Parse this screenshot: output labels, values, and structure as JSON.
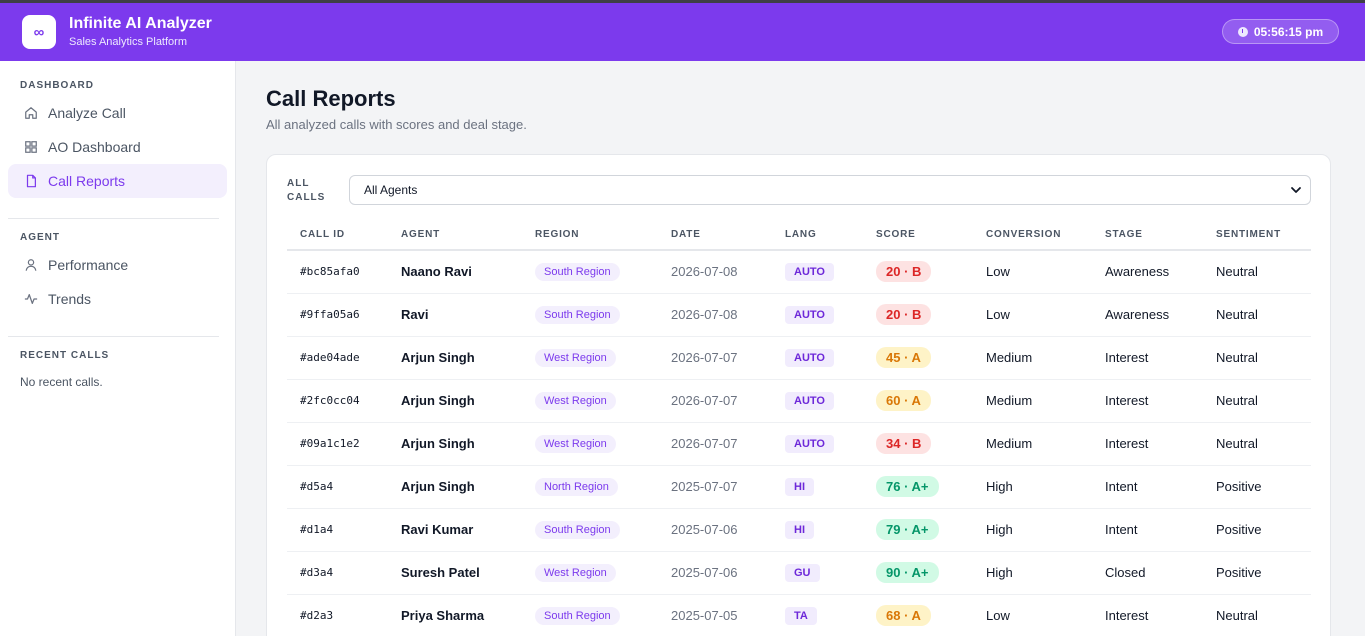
{
  "header": {
    "logo_glyph": "∞",
    "title": "Infinite AI Analyzer",
    "subtitle": "Sales Analytics Platform",
    "clock": "05:56:15 pm",
    "brand_color": "#7c3aed"
  },
  "sidebar": {
    "dashboard_label": "DASHBOARD",
    "dashboard_items": [
      {
        "label": "Analyze Call",
        "icon": "home-icon"
      },
      {
        "label": "AO Dashboard",
        "icon": "grid-icon"
      },
      {
        "label": "Call Reports",
        "icon": "file-icon",
        "active": true
      }
    ],
    "agent_label": "AGENT",
    "agent_items": [
      {
        "label": "Performance",
        "icon": "user-icon"
      },
      {
        "label": "Trends",
        "icon": "activity-icon"
      }
    ],
    "recent_label": "RECENT CALLS",
    "recent_empty": "No recent calls."
  },
  "main": {
    "title": "Call Reports",
    "subtitle": "All analyzed calls with scores and deal stage.",
    "filter_label": "ALL CALLS",
    "filter_value": "All Agents",
    "columns": [
      "CALL ID",
      "AGENT",
      "REGION",
      "DATE",
      "LANG",
      "SCORE",
      "CONVERSION",
      "STAGE",
      "SENTIMENT"
    ],
    "rows": [
      {
        "id": "#bc85afa0",
        "agent": "Naano Ravi",
        "region": "South Region",
        "date": "2026-07-08",
        "lang": "AUTO",
        "score": "20 · B",
        "level": "low",
        "conversion": "Low",
        "stage": "Awareness",
        "sentiment": "Neutral"
      },
      {
        "id": "#9ffa05a6",
        "agent": "Ravi",
        "region": "South Region",
        "date": "2026-07-08",
        "lang": "AUTO",
        "score": "20 · B",
        "level": "low",
        "conversion": "Low",
        "stage": "Awareness",
        "sentiment": "Neutral"
      },
      {
        "id": "#ade04ade",
        "agent": "Arjun Singh",
        "region": "West Region",
        "date": "2026-07-07",
        "lang": "AUTO",
        "score": "45 · A",
        "level": "mid",
        "conversion": "Medium",
        "stage": "Interest",
        "sentiment": "Neutral"
      },
      {
        "id": "#2fc0cc04",
        "agent": "Arjun Singh",
        "region": "West Region",
        "date": "2026-07-07",
        "lang": "AUTO",
        "score": "60 · A",
        "level": "mid",
        "conversion": "Medium",
        "stage": "Interest",
        "sentiment": "Neutral"
      },
      {
        "id": "#09a1c1e2",
        "agent": "Arjun Singh",
        "region": "West Region",
        "date": "2026-07-07",
        "lang": "AUTO",
        "score": "34 · B",
        "level": "low",
        "conversion": "Medium",
        "stage": "Interest",
        "sentiment": "Neutral"
      },
      {
        "id": "#d5a4",
        "agent": "Arjun Singh",
        "region": "North Region",
        "date": "2025-07-07",
        "lang": "HI",
        "score": "76 · A+",
        "level": "high",
        "conversion": "High",
        "stage": "Intent",
        "sentiment": "Positive"
      },
      {
        "id": "#d1a4",
        "agent": "Ravi Kumar",
        "region": "South Region",
        "date": "2025-07-06",
        "lang": "HI",
        "score": "79 · A+",
        "level": "high",
        "conversion": "High",
        "stage": "Intent",
        "sentiment": "Positive"
      },
      {
        "id": "#d3a4",
        "agent": "Suresh Patel",
        "region": "West Region",
        "date": "2025-07-06",
        "lang": "GU",
        "score": "90 · A+",
        "level": "high",
        "conversion": "High",
        "stage": "Closed",
        "sentiment": "Positive"
      },
      {
        "id": "#d2a3",
        "agent": "Priya Sharma",
        "region": "South Region",
        "date": "2025-07-05",
        "lang": "TA",
        "score": "68 · A",
        "level": "mid",
        "conversion": "Low",
        "stage": "Interest",
        "sentiment": "Neutral"
      }
    ]
  }
}
